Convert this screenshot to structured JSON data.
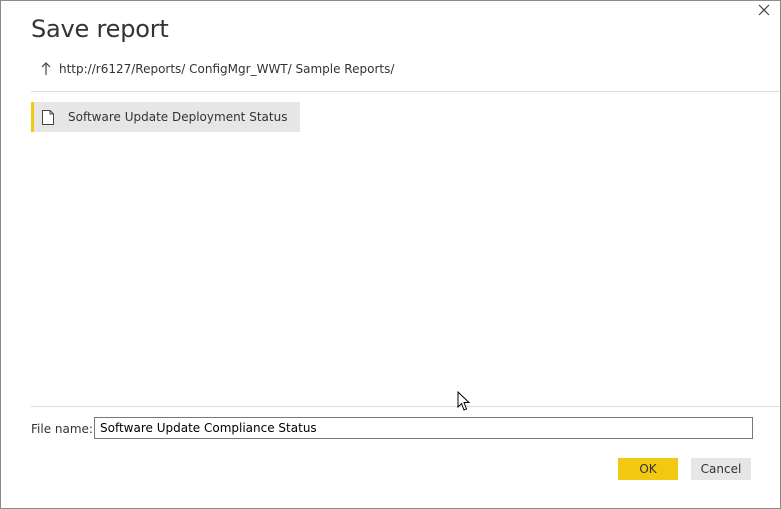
{
  "dialog": {
    "title": "Save report",
    "close_icon": "close-icon"
  },
  "path": {
    "up_icon": "up-arrow-icon",
    "url": "http://r6127/Reports/ ConfigMgr_WWT/ Sample Reports/"
  },
  "items": [
    {
      "icon": "file-icon",
      "label": "Software Update Deployment Status",
      "selected": true
    }
  ],
  "filename": {
    "label": "File name:",
    "value": "Software Update Compliance Status"
  },
  "buttons": {
    "ok": "OK",
    "cancel": "Cancel"
  },
  "colors": {
    "accent": "#f2c811",
    "item_bg": "#e6e6e6"
  }
}
